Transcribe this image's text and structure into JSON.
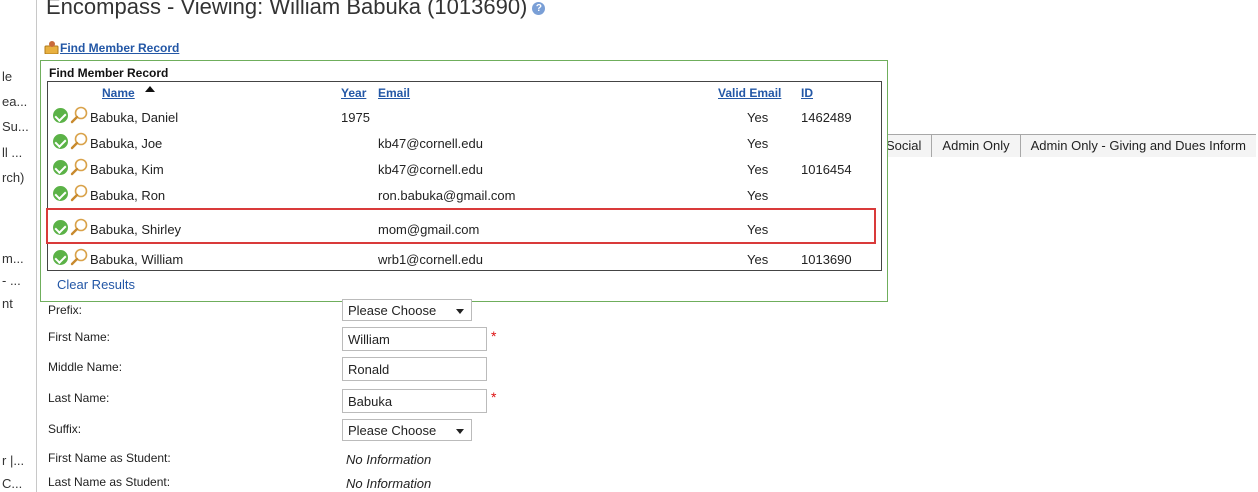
{
  "page": {
    "title": "Encompass  - Viewing: William Babuka (1013690)",
    "help_icon": "help-icon"
  },
  "sidebar": {
    "fragments": [
      "le",
      "ea...",
      "Su...",
      "ll ...",
      "rch)",
      "m...",
      "- ...",
      "nt",
      "r |...",
      "C..."
    ]
  },
  "find_link": {
    "icon": "person-search-icon",
    "label": "Find Member Record"
  },
  "popup": {
    "title": "Find Member Record",
    "columns": {
      "name": "Name",
      "year": "Year",
      "email": "Email",
      "valid_email": "Valid Email",
      "id": "ID"
    },
    "rows": [
      {
        "name": "Babuka, Daniel",
        "year": "1975",
        "email": "",
        "valid": "Yes",
        "id": "1462489"
      },
      {
        "name": "Babuka, Joe",
        "year": "",
        "email": "kb47@cornell.edu",
        "valid": "Yes",
        "id": ""
      },
      {
        "name": "Babuka, Kim",
        "year": "",
        "email": "kb47@cornell.edu",
        "valid": "Yes",
        "id": "1016454"
      },
      {
        "name": "Babuka, Ron",
        "year": "",
        "email": "ron.babuka@gmail.com",
        "valid": "Yes",
        "id": ""
      },
      {
        "name": "Babuka, Shirley",
        "year": "",
        "email": "mom@gmail.com",
        "valid": "Yes",
        "id": ""
      },
      {
        "name": "Babuka, William",
        "year": "",
        "email": "wrb1@cornell.edu",
        "valid": "Yes",
        "id": "1013690"
      }
    ],
    "clear_label": "Clear Results",
    "row_icons": [
      "check-icon",
      "magnifier-icon"
    ]
  },
  "tabs": [
    "Social",
    "Admin Only",
    "Admin Only - Giving and Dues Inform"
  ],
  "form": {
    "prefix": {
      "label": "Prefix:",
      "value": "Please Choose"
    },
    "first_name": {
      "label": "First Name:",
      "value": "William",
      "required": "*"
    },
    "middle_name": {
      "label": "Middle Name:",
      "value": "Ronald"
    },
    "last_name": {
      "label": "Last Name:",
      "value": "Babuka",
      "required": "*"
    },
    "suffix": {
      "label": "Suffix:",
      "value": "Please Choose"
    },
    "first_student": {
      "label": "First Name as Student:",
      "value": "No Information"
    },
    "last_student": {
      "label": "Last Name as Student:",
      "value": "No Information"
    }
  },
  "colors": {
    "link": "#2357a6",
    "highlight": "#d93a3a",
    "check": "#5bb247",
    "popup_border": "#6fae5c"
  }
}
